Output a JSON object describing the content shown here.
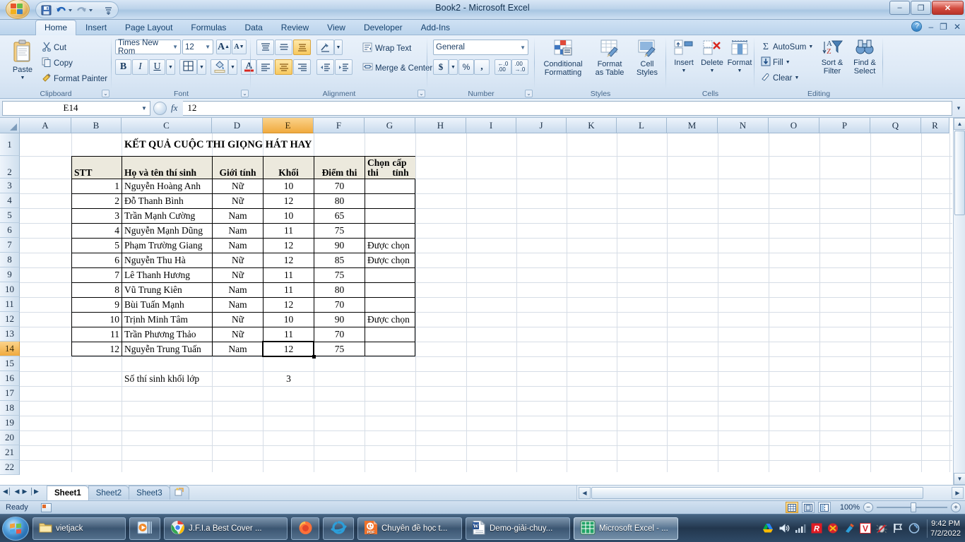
{
  "window": {
    "title": "Book2 - Microsoft Excel",
    "minimize": "–",
    "restore": "❐",
    "close": "✕"
  },
  "quick_access": {
    "save": "save-icon",
    "undo": "undo-icon",
    "redo": "redo-icon",
    "more": "more-icon"
  },
  "ribbon": {
    "tabs": [
      {
        "label": "Home",
        "active": true
      },
      {
        "label": "Insert",
        "active": false
      },
      {
        "label": "Page Layout",
        "active": false
      },
      {
        "label": "Formulas",
        "active": false
      },
      {
        "label": "Data",
        "active": false
      },
      {
        "label": "Review",
        "active": false
      },
      {
        "label": "View",
        "active": false
      },
      {
        "label": "Developer",
        "active": false
      },
      {
        "label": "Add-Ins",
        "active": false
      }
    ],
    "help": "?",
    "win_min": "–",
    "win_restore": "❐",
    "win_close": "✕",
    "clipboard": {
      "label": "Clipboard",
      "paste": "Paste",
      "cut": "Cut",
      "copy": "Copy",
      "format_painter": "Format Painter"
    },
    "font": {
      "label": "Font",
      "font_name": "Times New Rom",
      "font_size": "12",
      "grow": "A",
      "shrink": "A",
      "bold": "B",
      "italic": "I",
      "underline": "U",
      "borders": "borders-icon",
      "fill_color": "fill-color-icon",
      "font_color": "A"
    },
    "alignment": {
      "label": "Alignment",
      "top": "align-top-icon",
      "middle": "align-middle-icon",
      "bottom": "align-bottom-icon",
      "orientation": "orientation-icon",
      "align_left": "align-left-icon",
      "align_center": "align-center-icon",
      "align_right": "align-right-icon",
      "decrease_indent": "decrease-indent-icon",
      "increase_indent": "increase-indent-icon",
      "wrap_text": "Wrap Text",
      "merge_center": "Merge & Center"
    },
    "number": {
      "label": "Number",
      "format": "General",
      "currency": "$",
      "percent": "%",
      "comma": ",",
      "increase_decimal": ".00",
      "decrease_decimal": ".00"
    },
    "styles": {
      "label": "Styles",
      "conditional_formatting": "Conditional\nFormatting",
      "cf_line1": "Conditional",
      "cf_line2": "Formatting",
      "fat_line1": "Format",
      "fat_line2": "as Table",
      "cs_line1": "Cell",
      "cs_line2": "Styles"
    },
    "cells": {
      "label": "Cells",
      "insert": "Insert",
      "delete": "Delete",
      "format": "Format"
    },
    "editing": {
      "label": "Editing",
      "autosum": "AutoSum",
      "fill": "Fill",
      "clear": "Clear",
      "sort_line1": "Sort &",
      "sort_line2": "Filter",
      "find_line1": "Find &",
      "find_line2": "Select"
    }
  },
  "formula_bar": {
    "name_box": "E14",
    "fx": "fx",
    "value": "12",
    "expand": "▾"
  },
  "grid": {
    "columns": [
      "A",
      "B",
      "C",
      "D",
      "E",
      "F",
      "G",
      "H",
      "I",
      "J",
      "K",
      "L",
      "M",
      "N",
      "O",
      "P",
      "Q",
      "R"
    ],
    "selected_column": "E",
    "rows": [
      "1",
      "2",
      "3",
      "4",
      "5",
      "6",
      "7",
      "8",
      "9",
      "10",
      "11",
      "12",
      "13",
      "14",
      "15",
      "16",
      "17",
      "18",
      "19",
      "20",
      "21",
      "22"
    ],
    "selected_row": "14",
    "selected_cell": "E14"
  },
  "sheet": {
    "title": "KẾT QUẢ CUỘC THI GIỌNG HÁT HAY",
    "headers": [
      "STT",
      "Họ và tên thí sinh",
      "Giới tính",
      "Khối",
      "Điểm thi",
      "Chọn thi cấp tỉnh"
    ],
    "header_g_line1": "Chọn thi",
    "header_g_line2": "cấp tỉnh",
    "rows": [
      {
        "stt": "1",
        "name": "Nguyễn Hoàng Anh",
        "gender": "Nữ",
        "khoi": "10",
        "diem": "70",
        "chon": ""
      },
      {
        "stt": "2",
        "name": "Đỗ Thanh Bình",
        "gender": "Nữ",
        "khoi": "12",
        "diem": "80",
        "chon": ""
      },
      {
        "stt": "3",
        "name": "Trần Mạnh Cường",
        "gender": "Nam",
        "khoi": "10",
        "diem": "65",
        "chon": ""
      },
      {
        "stt": "4",
        "name": "Nguyễn Mạnh Dũng",
        "gender": "Nam",
        "khoi": "11",
        "diem": "75",
        "chon": ""
      },
      {
        "stt": "5",
        "name": "Phạm Trường Giang",
        "gender": "Nam",
        "khoi": "12",
        "diem": "90",
        "chon": "Được chọn"
      },
      {
        "stt": "6",
        "name": "Nguyễn Thu Hà",
        "gender": "Nữ",
        "khoi": "12",
        "diem": "85",
        "chon": "Được chọn"
      },
      {
        "stt": "7",
        "name": "Lê Thanh Hương",
        "gender": "Nữ",
        "khoi": "11",
        "diem": "75",
        "chon": ""
      },
      {
        "stt": "8",
        "name": "Vũ Trung Kiên",
        "gender": "Nam",
        "khoi": "11",
        "diem": "80",
        "chon": ""
      },
      {
        "stt": "9",
        "name": "Bùi Tuấn Mạnh",
        "gender": "Nam",
        "khoi": "12",
        "diem": "70",
        "chon": ""
      },
      {
        "stt": "10",
        "name": "Trịnh Minh Tâm",
        "gender": "Nữ",
        "khoi": "10",
        "diem": "90",
        "chon": "Được chọn"
      },
      {
        "stt": "11",
        "name": "Trần Phương Thảo",
        "gender": "Nữ",
        "khoi": "11",
        "diem": "70",
        "chon": ""
      },
      {
        "stt": "12",
        "name": "Nguyễn Trung Tuấn",
        "gender": "Nam",
        "khoi": "12",
        "diem": "75",
        "chon": ""
      }
    ],
    "summary_label": "Số thí sinh khối lớp",
    "summary_value": "3"
  },
  "sheet_tabs": {
    "first": "◀│",
    "prev": "◀",
    "next": "▶",
    "last": "│▶",
    "items": [
      {
        "label": "Sheet1",
        "active": true
      },
      {
        "label": "Sheet2",
        "active": false
      },
      {
        "label": "Sheet3",
        "active": false
      }
    ],
    "insert_sheet": "insert-sheet-icon"
  },
  "status_bar": {
    "ready": "Ready",
    "macro_record": "macro-record-icon",
    "view_normal": "normal-view-icon",
    "view_layout": "page-layout-view-icon",
    "view_break": "page-break-view-icon",
    "zoom": "100%",
    "zoom_out": "−",
    "zoom_in": "+"
  },
  "taskbar": {
    "start": "start-orb-icon",
    "items": [
      {
        "label": "vietjack",
        "icon": "folder-icon"
      },
      {
        "label": "",
        "icon": "media-player-icon"
      },
      {
        "label": "J.F.I.a Best Cover ...",
        "icon": "chrome-icon"
      },
      {
        "label": "",
        "icon": "firefox-icon"
      },
      {
        "label": "",
        "icon": "internet-explorer-icon"
      },
      {
        "label": "Chuyên đề học t...",
        "icon": "pdf-icon"
      },
      {
        "label": "Demo-giải-chuy...",
        "icon": "word-icon"
      },
      {
        "label": "Microsoft Excel - ...",
        "icon": "excel-icon"
      }
    ],
    "tray": [
      "google-drive-icon",
      "volume-icon",
      "network-icon",
      "antivirus-icon",
      "unikey-icon",
      "cleaner-icon",
      "v-icon",
      "bug-icon",
      "flag-icon",
      "sync-icon"
    ],
    "time": "9:42 PM",
    "date": "7/2/2022"
  }
}
